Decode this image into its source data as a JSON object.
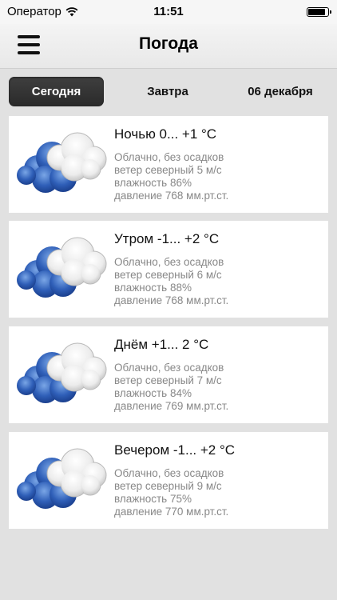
{
  "status_bar": {
    "carrier": "Оператор",
    "time": "11:51",
    "battery_level": 0.9
  },
  "nav": {
    "title": "Погода",
    "menu_icon": "hamburger-menu-icon"
  },
  "tabs": [
    {
      "label": "Сегодня",
      "active": true
    },
    {
      "label": "Завтра",
      "active": false
    },
    {
      "label": "06 декабря",
      "active": false
    }
  ],
  "forecasts": [
    {
      "icon": "cloudy-icon",
      "title": "Ночью 0... +1 °C",
      "condition": "Облачно, без осадков",
      "wind": "ветер северный 5 м/с",
      "humidity": "влажность 86%",
      "pressure": "давление 768 мм.рт.ст."
    },
    {
      "icon": "cloudy-icon",
      "title": "Утром -1... +2 °C",
      "condition": "Облачно, без осадков",
      "wind": "ветер северный 6 м/с",
      "humidity": "влажность 88%",
      "pressure": "давление 768 мм.рт.ст."
    },
    {
      "icon": "cloudy-icon",
      "title": "Днём +1... 2 °C",
      "condition": "Облачно, без осадков",
      "wind": "ветер северный 7 м/с",
      "humidity": "влажность 84%",
      "pressure": "давление 769 мм.рт.ст."
    },
    {
      "icon": "cloudy-icon",
      "title": "Вечером -1... +2 °C",
      "condition": "Облачно, без осадков",
      "wind": "ветер северный 9 м/с",
      "humidity": "влажность 75%",
      "pressure": "давление 770 мм.рт.ст."
    }
  ]
}
